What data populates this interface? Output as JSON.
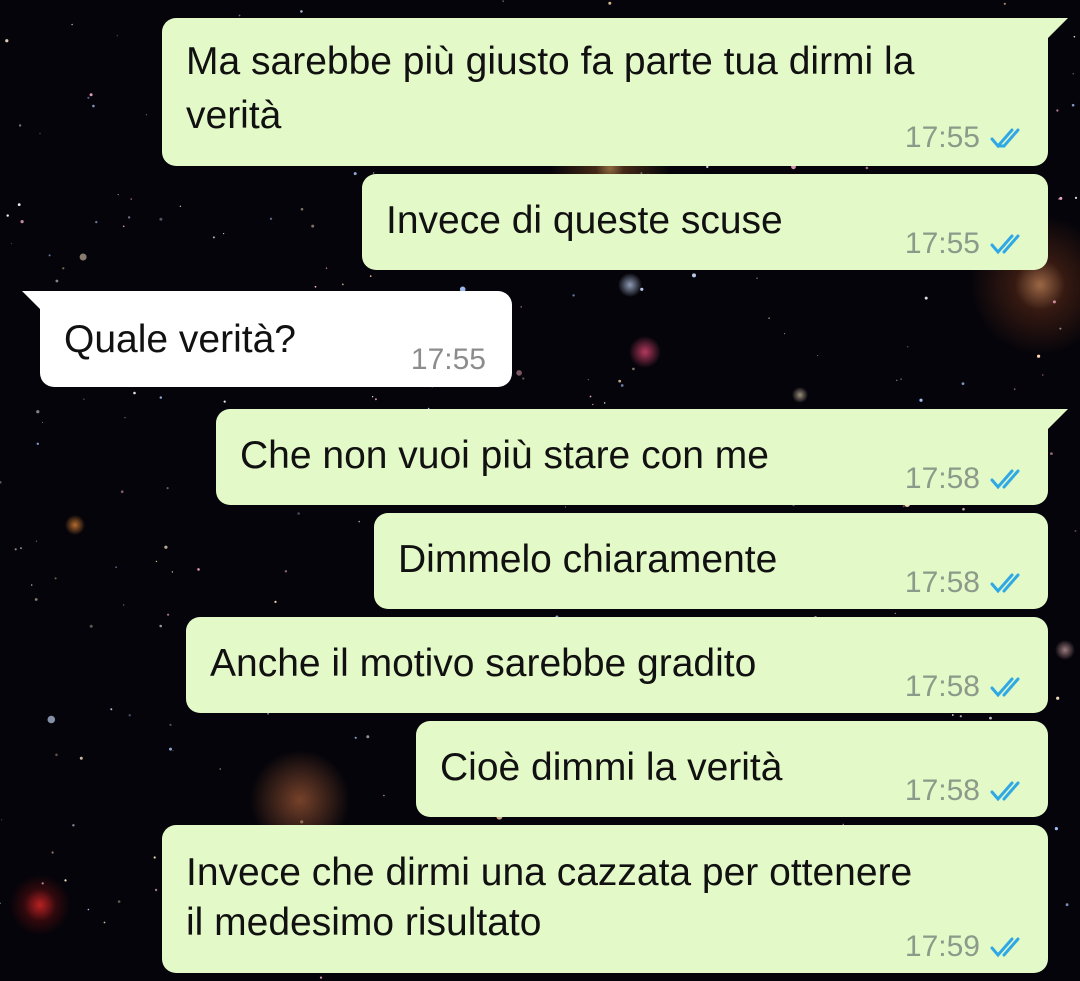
{
  "colors": {
    "outgoing_bubble": "#e4f9c8",
    "incoming_bubble": "#ffffff",
    "read_ticks": "#2fa8e6",
    "timestamp": "#8c9a8a"
  },
  "icons": {
    "read_receipt": "double-check-icon"
  },
  "messages": [
    {
      "direction": "out",
      "lines": [
        "Ma sarebbe più giusto fa parte tua dirmi la",
        "verità"
      ],
      "time": "17:55",
      "read": true
    },
    {
      "direction": "out",
      "lines": [
        "Invece di queste scuse"
      ],
      "time": "17:55",
      "read": true
    },
    {
      "direction": "in",
      "lines": [
        "Quale verità?"
      ],
      "time": "17:55"
    },
    {
      "direction": "out",
      "lines": [
        "Che non vuoi più stare con me"
      ],
      "time": "17:58",
      "read": true
    },
    {
      "direction": "out",
      "lines": [
        "Dimmelo chiaramente"
      ],
      "time": "17:58",
      "read": true
    },
    {
      "direction": "out",
      "lines": [
        "Anche il motivo sarebbe gradito"
      ],
      "time": "17:58",
      "read": true
    },
    {
      "direction": "out",
      "lines": [
        "Cioè dimmi la verità"
      ],
      "time": "17:58",
      "read": true
    },
    {
      "direction": "out",
      "lines": [
        "Invece che dirmi una cazzata per ottenere",
        "il medesimo risultato"
      ],
      "time": "17:59",
      "read": true
    }
  ]
}
